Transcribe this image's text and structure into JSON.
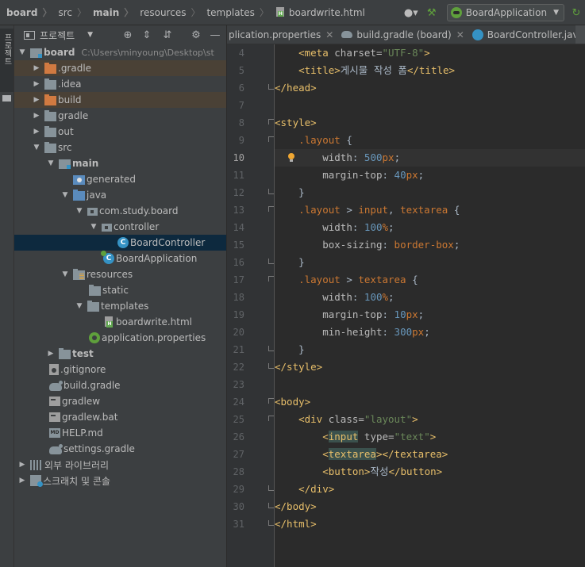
{
  "breadcrumbs": [
    "board",
    "src",
    "main",
    "resources",
    "templates",
    "boardwrite.html"
  ],
  "run_config": {
    "label": "BoardApplication"
  },
  "tool_stripe": {
    "label": "프로젝트"
  },
  "project_panel": {
    "title": "프로젝트",
    "root_label": "board",
    "root_path": "C:\\Users\\minyoung\\Desktop\\st",
    "tree": {
      "gradle_dir": ".gradle",
      "idea": ".idea",
      "build": "build",
      "gradle": "gradle",
      "out": "out",
      "src": "src",
      "main": "main",
      "generated": "generated",
      "java": "java",
      "pkg": "com.study.board",
      "controller": "controller",
      "board_controller": "BoardController",
      "board_application": "BoardApplication",
      "resources": "resources",
      "static": "static",
      "templates": "templates",
      "boardwrite": "boardwrite.html",
      "app_props": "application.properties",
      "test": "test",
      "gitignore": ".gitignore",
      "build_gradle": "build.gradle",
      "gradlew": "gradlew",
      "gradlew_bat": "gradlew.bat",
      "help": "HELP.md",
      "settings": "settings.gradle",
      "ext_libs": "외부 라이브러리",
      "scratches": "스크래치 및 콘솔"
    }
  },
  "tabs": [
    {
      "label": "plication.properties"
    },
    {
      "label": "build.gradle (board)"
    },
    {
      "label": "BoardController.java"
    }
  ],
  "editor": {
    "current_line": 10,
    "lines": [
      {
        "n": "4",
        "tokens": [
          [
            "    ",
            ""
          ],
          [
            "<meta ",
            "t"
          ],
          [
            "charset=",
            "attr"
          ],
          [
            "\"UTF-8\"",
            "str"
          ],
          [
            ">",
            "t"
          ]
        ]
      },
      {
        "n": "5",
        "tokens": [
          [
            "    ",
            ""
          ],
          [
            "<title>",
            "t"
          ],
          [
            "게시물 작성 폼",
            ""
          ],
          [
            "</title>",
            "t"
          ]
        ]
      },
      {
        "n": "6",
        "tokens": [
          [
            "</head>",
            "t"
          ]
        ]
      },
      {
        "n": "7",
        "tokens": []
      },
      {
        "n": "8",
        "tokens": [
          [
            "<style>",
            "t"
          ]
        ]
      },
      {
        "n": "9",
        "tokens": [
          [
            "    ",
            ""
          ],
          [
            ".layout",
            "kw"
          ],
          [
            " {",
            ""
          ]
        ]
      },
      {
        "n": "10",
        "tokens": [
          [
            "        ",
            ""
          ],
          [
            "width",
            "attr"
          ],
          [
            ": ",
            ""
          ],
          [
            "500",
            "num"
          ],
          [
            "px",
            "kw"
          ],
          [
            ";",
            ""
          ]
        ]
      },
      {
        "n": "11",
        "tokens": [
          [
            "        ",
            ""
          ],
          [
            "margin-top",
            "attr"
          ],
          [
            ": ",
            ""
          ],
          [
            "40",
            "num"
          ],
          [
            "px",
            "kw"
          ],
          [
            ";",
            ""
          ]
        ]
      },
      {
        "n": "12",
        "tokens": [
          [
            "    }",
            ""
          ]
        ]
      },
      {
        "n": "13",
        "tokens": [
          [
            "    ",
            ""
          ],
          [
            ".layout",
            "kw"
          ],
          [
            " > ",
            ""
          ],
          [
            "input",
            "kw"
          ],
          [
            ", ",
            ""
          ],
          [
            "textarea",
            "kw"
          ],
          [
            " {",
            ""
          ]
        ]
      },
      {
        "n": "14",
        "tokens": [
          [
            "        ",
            ""
          ],
          [
            "width",
            "attr"
          ],
          [
            ": ",
            ""
          ],
          [
            "100",
            "num"
          ],
          [
            "%",
            "kw"
          ],
          [
            ";",
            ""
          ]
        ]
      },
      {
        "n": "15",
        "tokens": [
          [
            "        ",
            ""
          ],
          [
            "box-sizing",
            "attr"
          ],
          [
            ": ",
            ""
          ],
          [
            "border-box",
            "kw"
          ],
          [
            ";",
            ""
          ]
        ]
      },
      {
        "n": "16",
        "tokens": [
          [
            "    }",
            ""
          ]
        ]
      },
      {
        "n": "17",
        "tokens": [
          [
            "    ",
            ""
          ],
          [
            ".layout",
            "kw"
          ],
          [
            " > ",
            ""
          ],
          [
            "textarea",
            "kw"
          ],
          [
            " {",
            ""
          ]
        ]
      },
      {
        "n": "18",
        "tokens": [
          [
            "        ",
            ""
          ],
          [
            "width",
            "attr"
          ],
          [
            ": ",
            ""
          ],
          [
            "100",
            "num"
          ],
          [
            "%",
            "kw"
          ],
          [
            ";",
            ""
          ]
        ]
      },
      {
        "n": "19",
        "tokens": [
          [
            "        ",
            ""
          ],
          [
            "margin-top",
            "attr"
          ],
          [
            ": ",
            ""
          ],
          [
            "10",
            "num"
          ],
          [
            "px",
            "kw"
          ],
          [
            ";",
            ""
          ]
        ]
      },
      {
        "n": "20",
        "tokens": [
          [
            "        ",
            ""
          ],
          [
            "min-height",
            "attr"
          ],
          [
            ": ",
            ""
          ],
          [
            "300",
            "num"
          ],
          [
            "px",
            "kw"
          ],
          [
            ";",
            ""
          ]
        ]
      },
      {
        "n": "21",
        "tokens": [
          [
            "    }",
            ""
          ]
        ]
      },
      {
        "n": "22",
        "tokens": [
          [
            "</style>",
            "t"
          ]
        ]
      },
      {
        "n": "23",
        "tokens": []
      },
      {
        "n": "24",
        "tokens": [
          [
            "<body>",
            "t"
          ]
        ]
      },
      {
        "n": "25",
        "tokens": [
          [
            "    ",
            ""
          ],
          [
            "<div ",
            "t"
          ],
          [
            "class=",
            "attr"
          ],
          [
            "\"layout\"",
            "str"
          ],
          [
            ">",
            "t"
          ]
        ]
      },
      {
        "n": "26",
        "tokens": [
          [
            "        ",
            ""
          ],
          [
            "<",
            "t"
          ],
          [
            "input",
            "t match"
          ],
          [
            " ",
            ""
          ],
          [
            "type=",
            "attr"
          ],
          [
            "\"text\"",
            "str"
          ],
          [
            ">",
            "t"
          ]
        ]
      },
      {
        "n": "27",
        "tokens": [
          [
            "        ",
            ""
          ],
          [
            "<",
            "t"
          ],
          [
            "textarea",
            "t match"
          ],
          [
            "></textarea>",
            "t"
          ]
        ]
      },
      {
        "n": "28",
        "tokens": [
          [
            "        ",
            ""
          ],
          [
            "<button>",
            "t"
          ],
          [
            "작성",
            ""
          ],
          [
            "</button>",
            "t"
          ]
        ]
      },
      {
        "n": "29",
        "tokens": [
          [
            "    ",
            ""
          ],
          [
            "</div>",
            "t"
          ]
        ]
      },
      {
        "n": "30",
        "tokens": [
          [
            "</body>",
            "t"
          ]
        ]
      },
      {
        "n": "31",
        "tokens": [
          [
            "</html>",
            "t"
          ]
        ]
      }
    ]
  }
}
